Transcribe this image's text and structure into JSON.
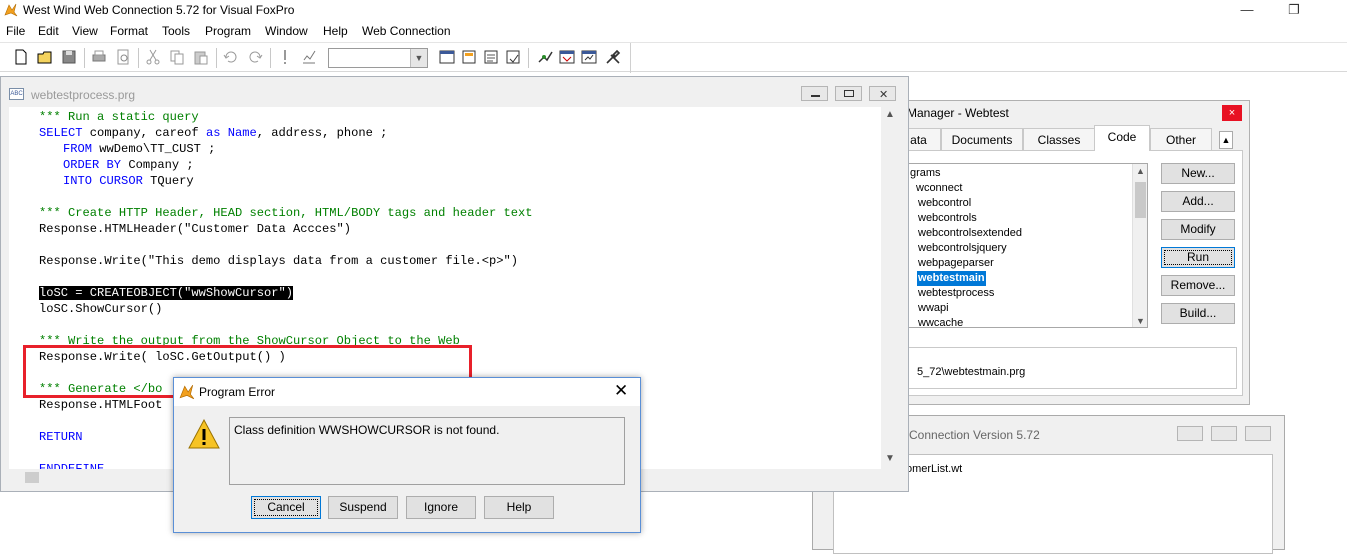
{
  "app": {
    "title": "West Wind Web Connection 5.72 for Visual FoxPro"
  },
  "menu": [
    "File",
    "Edit",
    "View",
    "Format",
    "Tools",
    "Program",
    "Window",
    "Help",
    "Web Connection"
  ],
  "project_manager": {
    "title": "Manager - Webtest",
    "close_glyph": "×",
    "tabs": [
      "ata",
      "Documents",
      "Classes",
      "Code",
      "Other"
    ],
    "active_tab": "Code",
    "list_items": [
      {
        "label": "grams",
        "selected": false
      },
      {
        "label": "wconnect",
        "selected": false
      },
      {
        "label": "webcontrol",
        "selected": false
      },
      {
        "label": "webcontrols",
        "selected": false
      },
      {
        "label": "webcontrolsextended",
        "selected": false
      },
      {
        "label": "webcontrolsjquery",
        "selected": false
      },
      {
        "label": "webpageparser",
        "selected": false
      },
      {
        "label": "webtestmain",
        "selected": true
      },
      {
        "label": "webtestprocess",
        "selected": false
      },
      {
        "label": "wwapi",
        "selected": false
      },
      {
        "label": "wwcache",
        "selected": false
      }
    ],
    "buttons": {
      "new": "New...",
      "add": "Add...",
      "modify": "Modify",
      "run": "Run",
      "remove": "Remove...",
      "build": "Build..."
    },
    "path": "5_72\\webtestmain.prg"
  },
  "server_window": {
    "title": "Connection Version 5.72",
    "content": "omerList.wt"
  },
  "editor": {
    "title": "webtestprocess.prg",
    "lines": {
      "l1": "*** Run a static query",
      "l2a": "SELECT",
      "l2b": " company, careof ",
      "l2c": "as",
      "l2d": " ",
      "l2e": "Name",
      "l2f": ", address, phone ;",
      "l3a": "FROM",
      "l3b": " wwDemo\\TT_CUST ;",
      "l4a": "ORDER BY",
      "l4b": " Company ;",
      "l5a": "INTO CURSOR",
      "l5b": " TQuery",
      "l6": "*** Create HTTP Header, HEAD section, HTML/BODY tags and header text",
      "l7": "Response.HTMLHeader(\"Customer Data Accces\")",
      "l8": "Response.Write(\"This demo displays data from a customer file.<p>\")",
      "l9": "loSC = CREATEOBJECT(\"wwShowCursor\")",
      "l10": "loSC.ShowCursor()",
      "l11": "*** Write the output from the ShowCursor Object to the Web",
      "l12": "Response.Write( loSC.GetOutput() )",
      "l13": "*** Generate </bo",
      "l14": "Response.HTMLFoot",
      "l15": "RETURN",
      "l16": "ENDDEFINE"
    }
  },
  "dialog": {
    "title": "Program Error",
    "close_glyph": "✕",
    "message": "Class definition WWSHOWCURSOR is not found.",
    "buttons": {
      "cancel": "Cancel",
      "suspend": "Suspend",
      "ignore": "Ignore",
      "help": "Help"
    }
  },
  "colors": {
    "comment": "#008000",
    "keyword": "#0000ff",
    "highlight_box": "#e8202a",
    "selection": "#0078d7"
  }
}
